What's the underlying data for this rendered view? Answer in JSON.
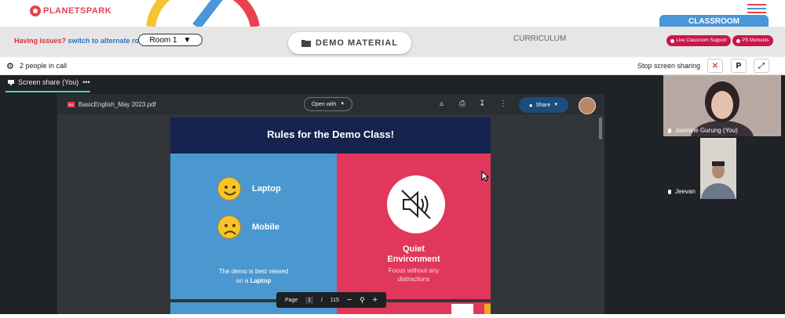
{
  "header": {
    "logo_text": "PLANETSPARK",
    "issues_text": "Having issues?",
    "alternate_link": "switch to alternate room",
    "room_selected": "Room 1",
    "demo_material": "DEMO MATERIAL",
    "curriculum": "CURRICULUM",
    "classroom_tab": "CLASSROOM",
    "live_support": "Live Classroom Support",
    "ps_moments": "PS Moments"
  },
  "callbar": {
    "people_count": "2 people in call",
    "stop_sharing": "Stop screen sharing",
    "p_button": "P"
  },
  "share": {
    "label": "Screen share (You)",
    "menu": "•••"
  },
  "pdf": {
    "badge": "PDF",
    "filename": "BasicEnglish_May 2023.pdf",
    "open_with": "Open with",
    "share": "Share",
    "page_label": "Page",
    "page_current": "1",
    "page_separator": "/",
    "page_total": "115"
  },
  "slide": {
    "title": "Rules for the Demo Class!",
    "laptop": "Laptop",
    "mobile": "Mobile",
    "best_viewed_1": "The demo is best viewed",
    "best_viewed_2": "on a ",
    "best_viewed_bold": "Laptop",
    "quiet_1": "Quiet",
    "quiet_2": "Environment",
    "focus_1": "Focus without any",
    "focus_2": "distractions"
  },
  "participants": [
    {
      "name": "Jasmine Gurung (You)"
    },
    {
      "name": "Jeevan"
    }
  ],
  "colors": {
    "brand_red": "#e8424e",
    "accent_blue": "#4a96d8",
    "pill_red": "#c8174b",
    "slide_navy": "#15234e",
    "slide_blue": "#4a98cf",
    "slide_red": "#e0375a"
  },
  "icons": [
    "gear-icon",
    "close-icon",
    "expand-icon",
    "folder-icon",
    "mic-icon",
    "printer-icon",
    "download-icon",
    "more-vert-icon",
    "globe-icon",
    "zoom-in-icon",
    "zoom-out-icon",
    "mute-speaker-icon",
    "hamburger-icon"
  ]
}
